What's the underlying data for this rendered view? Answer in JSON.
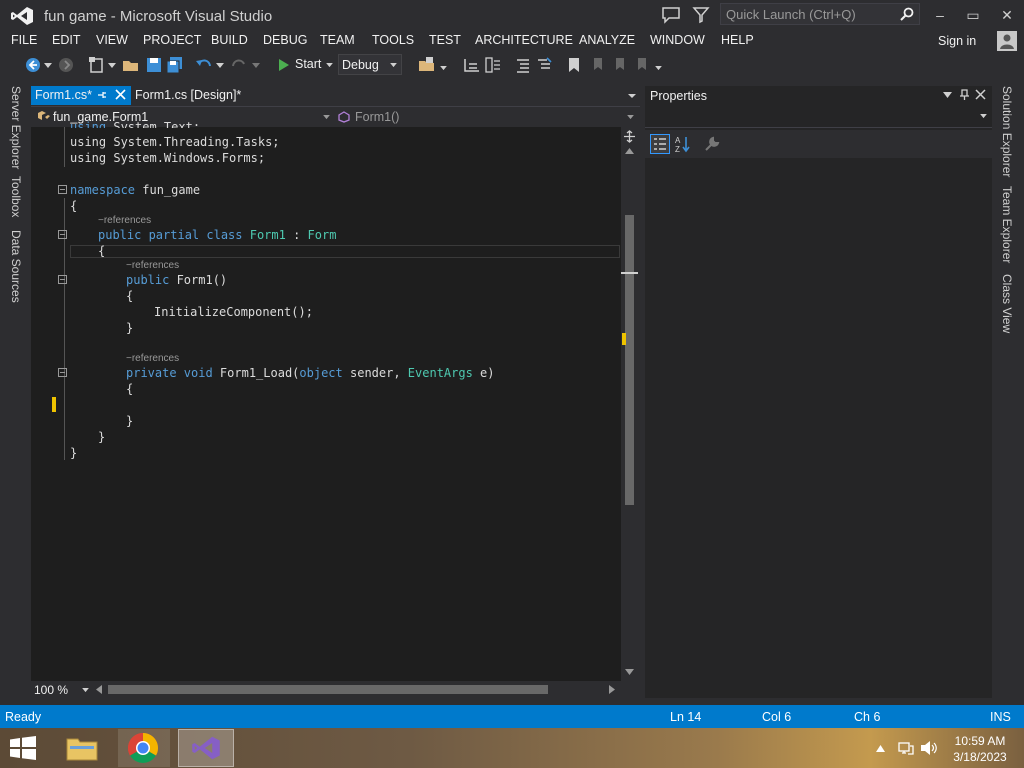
{
  "window": {
    "title": "fun game - Microsoft Visual Studio",
    "quick_launch_placeholder": "Quick Launch (Ctrl+Q)",
    "minimize": "–",
    "maximize": "▭",
    "close": "✕"
  },
  "menu": [
    "FILE",
    "EDIT",
    "VIEW",
    "PROJECT",
    "BUILD",
    "DEBUG",
    "TEAM",
    "TOOLS",
    "TEST",
    "ARCHITECTURE",
    "ANALYZE",
    "WINDOW",
    "HELP"
  ],
  "signin": "Sign in",
  "toolbar": {
    "start_label": "Start",
    "config_value": "Debug"
  },
  "left_tabs": [
    "Server Explorer",
    "Toolbox",
    "Data Sources"
  ],
  "right_tabs": [
    "Solution Explorer",
    "Team Explorer",
    "Class View"
  ],
  "tabs": [
    {
      "label": "Form1.cs*",
      "active": true
    },
    {
      "label": "Form1.cs [Design]*",
      "active": false
    }
  ],
  "navbar": {
    "left": "fun_game.Form1",
    "right": "Form1()"
  },
  "code": {
    "line0_partial": "using System.Text;",
    "line1": "using System.Threading.Tasks;",
    "line2": "using System.Windows.Forms;",
    "ns_kw": "namespace",
    "ns_name": " fun_game",
    "brace_open": "{",
    "brace_close": "}",
    "references": "−references",
    "class_kw": "public partial class",
    "class_name": " Form1 : ",
    "class_base": "Form",
    "ctor_kw": "public",
    "ctor_name": " Form1()",
    "init_call": "InitializeComponent();",
    "load_kw": "private void",
    "load_name": " Form1_Load(",
    "load_obj": "object",
    "load_sender": " sender, ",
    "load_args": "EventArgs",
    "load_e": " e)"
  },
  "editor_zoom": "100 %",
  "properties": {
    "title": "Properties"
  },
  "status": {
    "ready": "Ready",
    "ln": "Ln 14",
    "col": "Col 6",
    "ch": "Ch 6",
    "mode": "INS"
  },
  "clock": {
    "time": "10:59 AM",
    "date": "3/18/2023"
  },
  "colors": {
    "accent": "#007acc",
    "keyword": "#569cd6",
    "type": "#4ec9b0",
    "editor_bg": "#1e1e1e"
  }
}
